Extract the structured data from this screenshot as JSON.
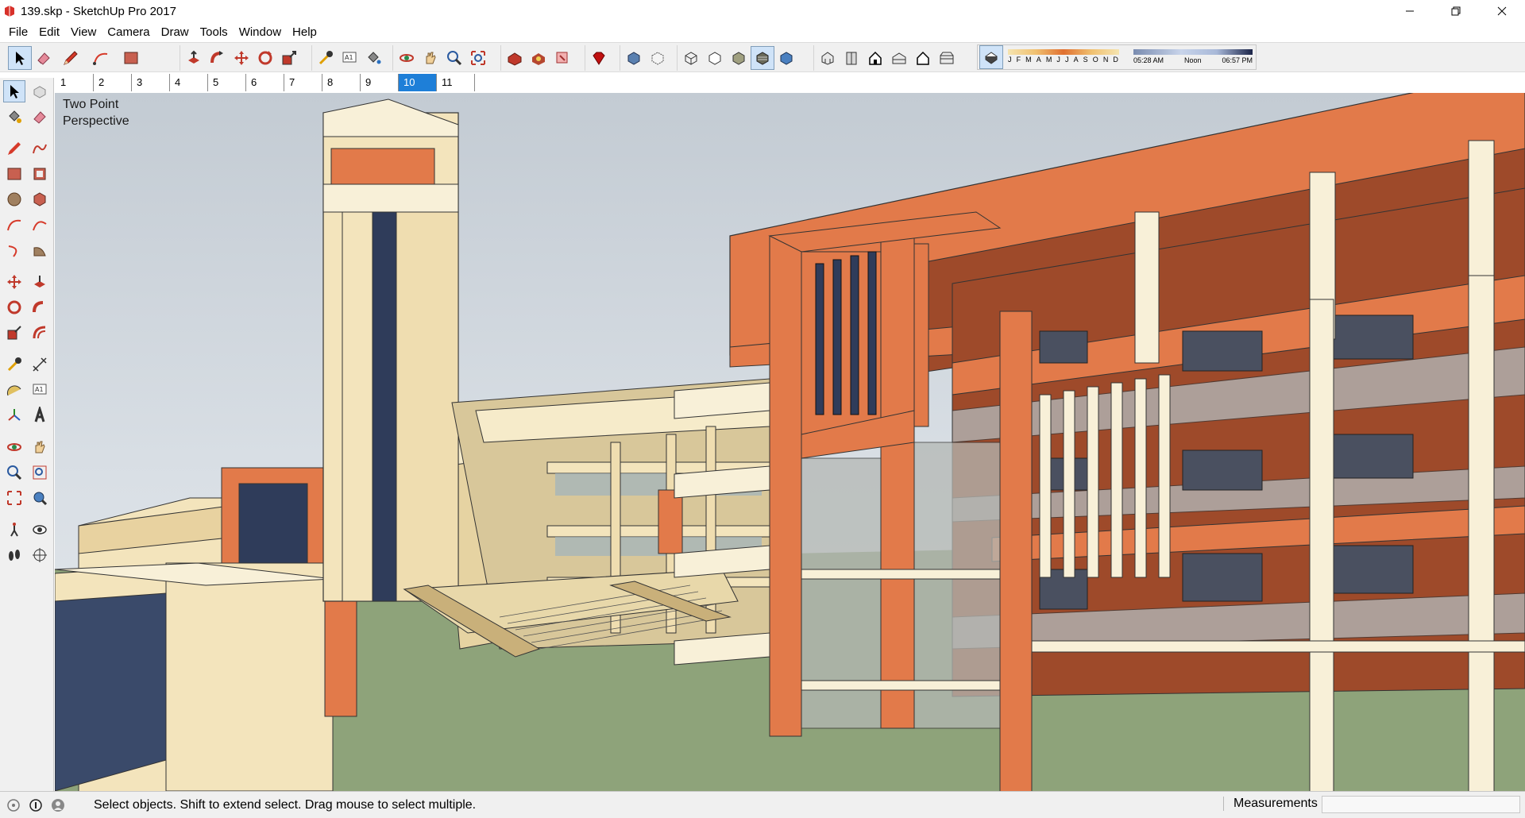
{
  "window": {
    "title": "139.skp - SketchUp Pro 2017",
    "app_icon": "sketchup-logo-icon",
    "controls": [
      "minimize-icon",
      "restore-icon",
      "close-icon"
    ]
  },
  "menu": {
    "items": [
      "File",
      "Edit",
      "View",
      "Camera",
      "Draw",
      "Tools",
      "Window",
      "Help"
    ]
  },
  "toolbar": {
    "groups": [
      [
        "select-icon",
        "eraser-icon",
        "pencil-icon",
        "arc-icon",
        "rectangle-icon"
      ],
      [
        "pushpull-icon",
        "followme-icon",
        "move-icon",
        "rotate-icon",
        "scale-icon"
      ],
      [
        "tape-measure-icon",
        "text-icon",
        "paint-bucket-icon"
      ],
      [
        "orbit-icon",
        "pan-icon",
        "zoom-icon",
        "zoom-extents-icon"
      ],
      [
        "3d-warehouse-icon",
        "extension-warehouse-icon",
        "layout-icon"
      ],
      [
        "ruby-icon"
      ],
      [
        "xray-icon",
        "back-edges-icon"
      ],
      [
        "wireframe-icon",
        "hidden-line-icon",
        "shaded-icon",
        "shaded-textures-icon",
        "monochrome-icon"
      ],
      [
        "iso-view-icon",
        "top-view-icon",
        "front-view-icon",
        "right-view-icon",
        "back-view-icon",
        "left-view-icon"
      ]
    ]
  },
  "shadow": {
    "toggle_icon": "shadow-toggle-icon",
    "months": [
      "J",
      "F",
      "M",
      "A",
      "M",
      "J",
      "J",
      "A",
      "S",
      "O",
      "N",
      "D"
    ],
    "time_start": "05:28 AM",
    "time_mid": "Noon",
    "time_end": "06:57 PM"
  },
  "scenes": {
    "tabs": [
      "1",
      "2",
      "3",
      "4",
      "5",
      "6",
      "7",
      "8",
      "9",
      "10",
      "11"
    ],
    "active": "10"
  },
  "viewport": {
    "camera_label": "Two Point Perspective"
  },
  "statusbar": {
    "icons": [
      "geo-location-icon",
      "credits-icon",
      "user-icon"
    ],
    "message": "Select objects. Shift to extend select. Drag mouse to select multiple.",
    "measurements_label": "Measurements",
    "measurements_value": ""
  },
  "colors": {
    "accent_orange": "#e27a4a",
    "cream": "#f5e9c8",
    "ground": "#8ea37a",
    "sky": "#c3cbd3",
    "active_tab": "#1e7fd8"
  }
}
